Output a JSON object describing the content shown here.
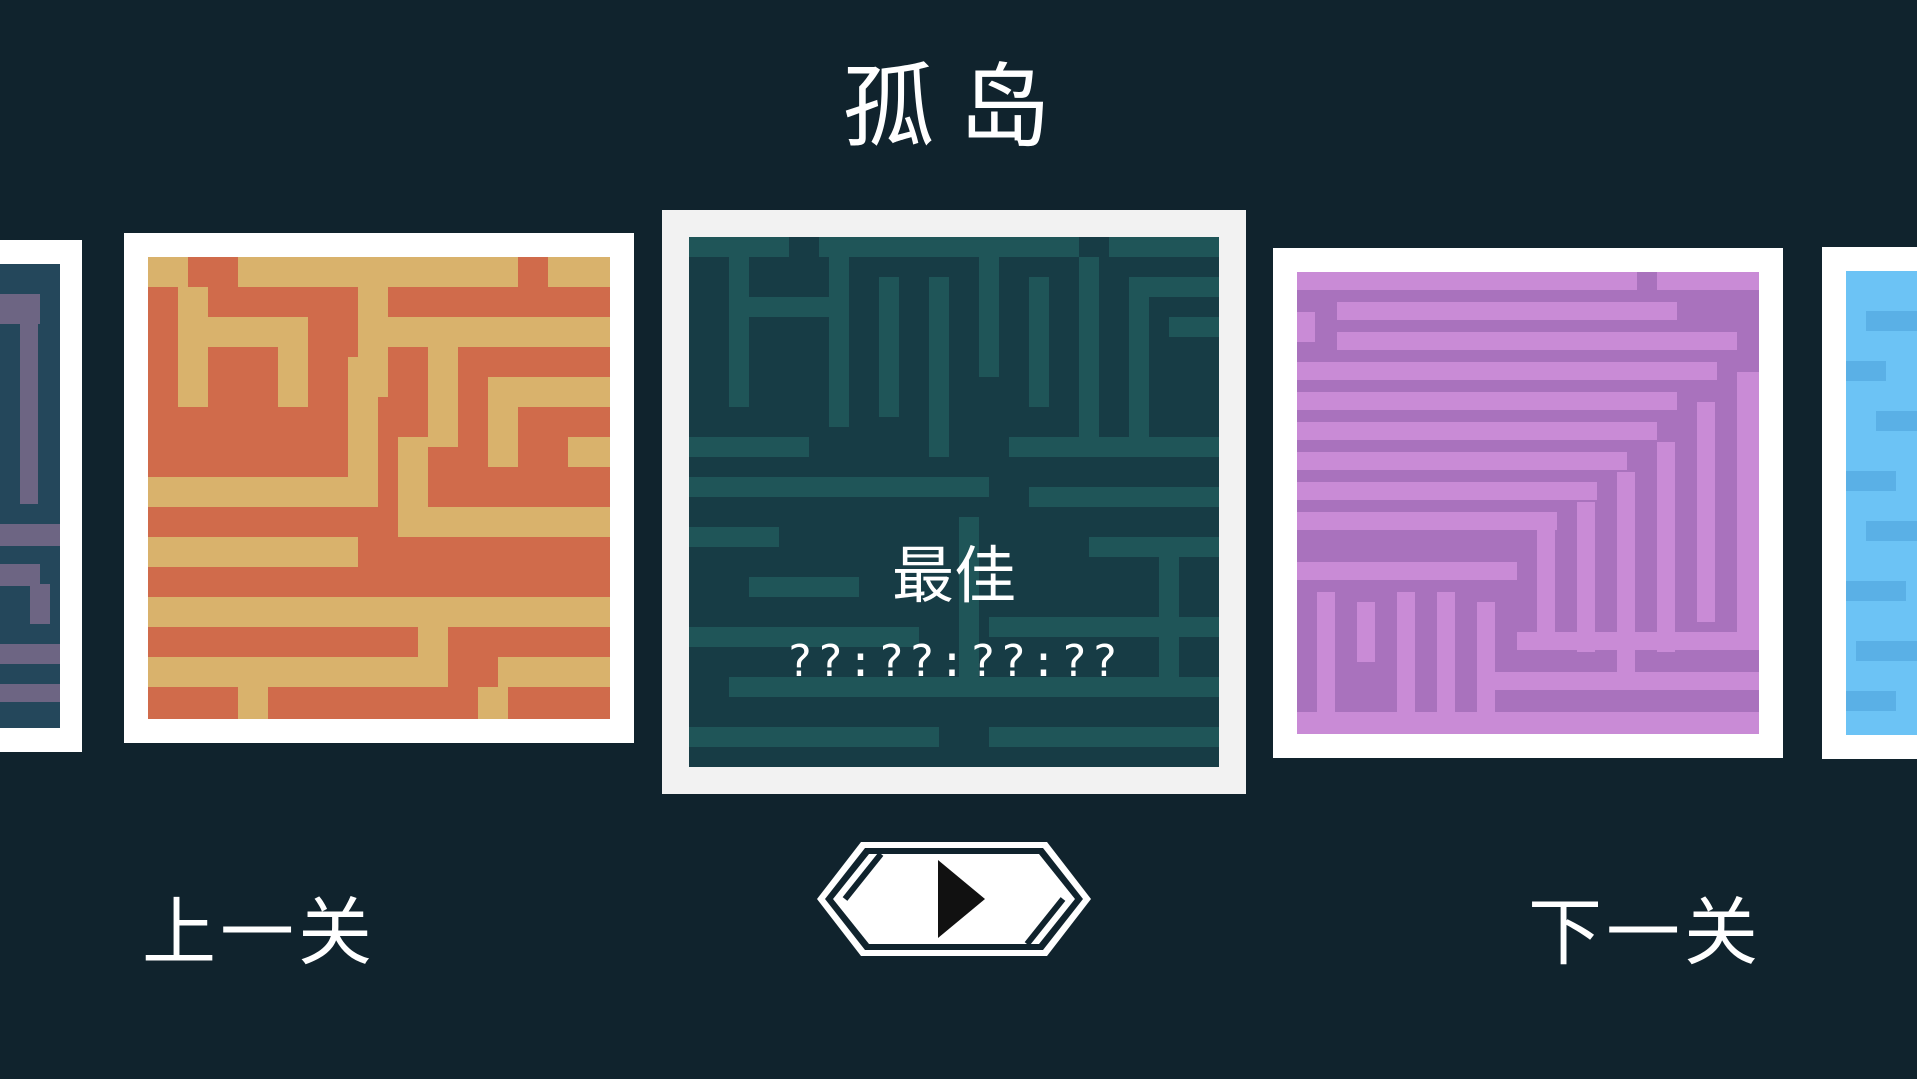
{
  "level": {
    "title": "孤岛"
  },
  "selected": {
    "best_label": "最佳",
    "best_time": "??:??:??:??"
  },
  "nav": {
    "prev_label": "上一关",
    "next_label": "下一关"
  },
  "icons": {
    "play": "play-triangle-icon"
  },
  "colors": {
    "background": "#10232d",
    "orange_path": "#d9b26c",
    "orange_wall": "#d06b4b",
    "teal_path": "#1f5558",
    "teal_wall": "#173c45",
    "purple_path": "#c98bd6",
    "purple_wall": "#a972bd",
    "blue_path": "#6cc3f5",
    "navy_path": "#6d6583",
    "navy_wall": "#24475b"
  }
}
